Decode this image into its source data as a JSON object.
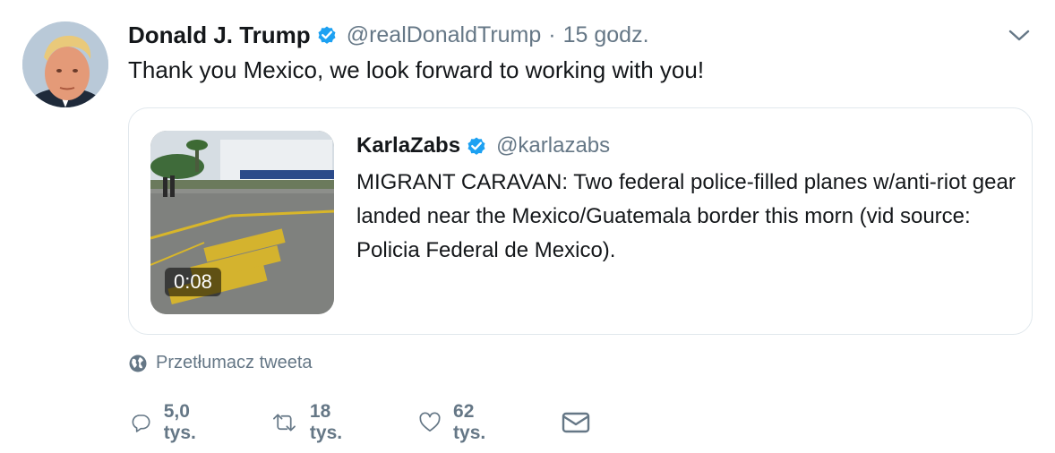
{
  "tweet": {
    "author_name": "Donald J. Trump",
    "author_handle": "@realDonaldTrump",
    "separator": "·",
    "time": "15 godz.",
    "text": "Thank you Mexico, we look forward to working with you!",
    "translate_label": "Przetłumacz tweeta"
  },
  "quoted": {
    "author_name": "KarlaZabs",
    "author_handle": "@karlazabs",
    "text": "MIGRANT CARAVAN: Two federal police-filled planes w/anti-riot gear landed near the Mexico/Guatemala border this morn (vid source: Policia Federal de Mexico).",
    "video_duration": "0:08"
  },
  "actions": {
    "reply_count": "5,0 tys.",
    "retweet_count": "18 tys.",
    "like_count": "62 tys."
  },
  "colors": {
    "verified": "#1da1f2",
    "muted": "#657786",
    "border": "#e1e8ed",
    "text": "#14171a"
  },
  "icons": {
    "verified": "verified-badge-icon",
    "caret": "chevron-down-icon",
    "globe": "globe-icon",
    "reply": "reply-icon",
    "retweet": "retweet-icon",
    "like": "heart-icon",
    "message": "envelope-icon"
  }
}
